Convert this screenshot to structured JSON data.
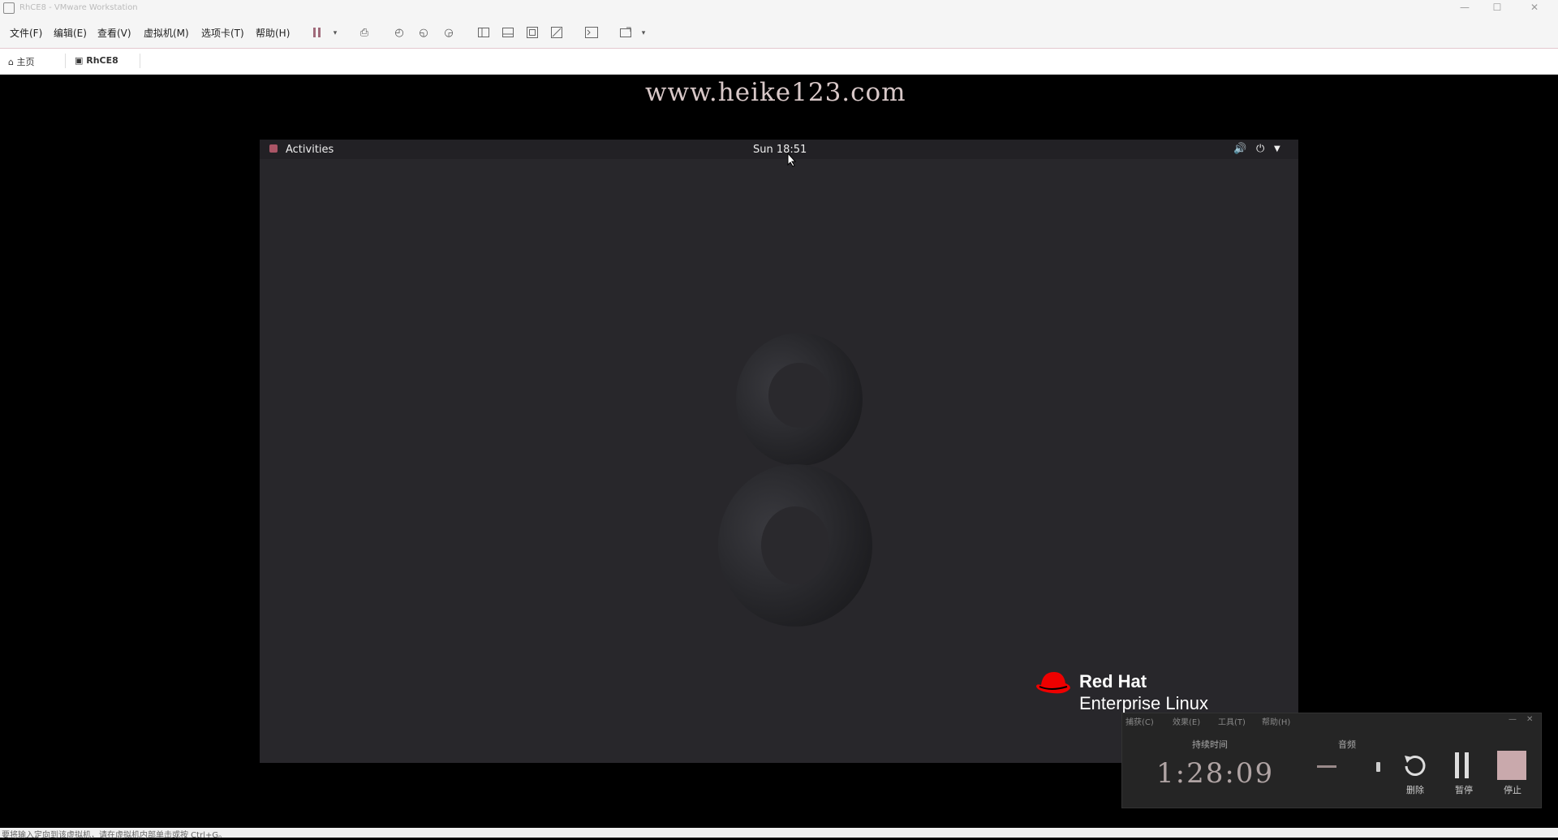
{
  "window": {
    "title": "RhCE8 - VMware Workstation",
    "minimize": "—",
    "maximize": "☐",
    "close": "✕"
  },
  "menubar": {
    "items": [
      "文件(F)",
      "编辑(E)",
      "查看(V)",
      "虚拟机(M)",
      "选项卡(T)",
      "帮助(H)"
    ]
  },
  "toolbar": {
    "icons": [
      "pause-icon",
      "send-keys-icon",
      "snapshot-icon",
      "revert-snapshot-icon",
      "manage-snapshots-icon",
      "sidebar-icon",
      "thumbnail-icon",
      "fullscreen-icon",
      "unity-icon",
      "console-icon",
      "stretch-icon"
    ]
  },
  "tabs": {
    "home_label": "主页",
    "vm_label": "RhCE8"
  },
  "watermark": "www.heike123.com",
  "gnome": {
    "activities": "Activities",
    "clock": "Sun 18:51",
    "brand_line1": "Red Hat",
    "brand_line2": "Enterprise Linux",
    "wallpaper_number": "8"
  },
  "recorder": {
    "menu": [
      "捕获(C)",
      "效果(E)",
      "工具(T)",
      "帮助(H)"
    ],
    "duration_label": "持续时间",
    "audio_label": "音频",
    "duration_value": "1:28:09",
    "delete_label": "删除",
    "pause_label": "暂停",
    "stop_label": "停止"
  },
  "statusbar": {
    "text": "要将输入定向到该虚拟机，请在虚拟机内部单击或按 Ctrl+G。"
  },
  "colors": {
    "accent": "#e4c8cf",
    "redhat_red": "#ee0000"
  }
}
